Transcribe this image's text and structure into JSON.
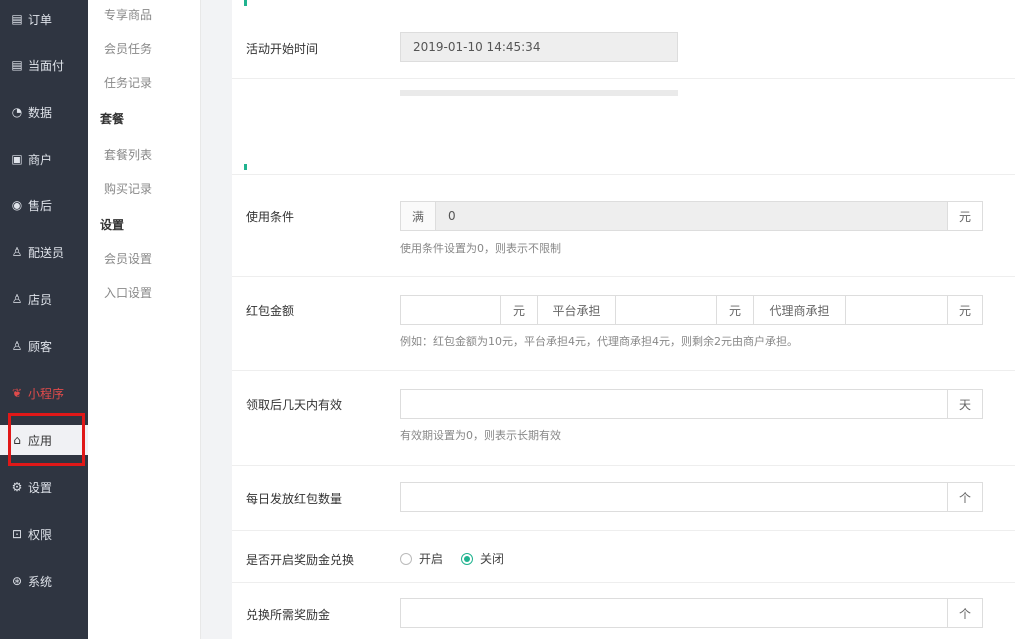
{
  "nav": {
    "items": [
      {
        "label": "订单",
        "icon": "order-icon",
        "glyph": "▤"
      },
      {
        "label": "当面付",
        "icon": "payment-icon",
        "glyph": "▤"
      },
      {
        "label": "数据",
        "icon": "chart-icon",
        "glyph": "◔"
      },
      {
        "label": "商户",
        "icon": "store-icon",
        "glyph": "▣"
      },
      {
        "label": "售后",
        "icon": "after-sales-icon",
        "glyph": "◉"
      },
      {
        "label": "配送员",
        "icon": "courier-icon",
        "glyph": "♙"
      },
      {
        "label": "店员",
        "icon": "staff-icon",
        "glyph": "♙"
      },
      {
        "label": "顾客",
        "icon": "customer-icon",
        "glyph": "♙"
      },
      {
        "label": "小程序",
        "icon": "miniprogram-icon",
        "glyph": "❦"
      },
      {
        "label": "应用",
        "icon": "app-icon",
        "glyph": "⌂"
      },
      {
        "label": "设置",
        "icon": "settings-icon",
        "glyph": "⚙"
      },
      {
        "label": "权限",
        "icon": "lock-icon",
        "glyph": "⊡"
      },
      {
        "label": "系统",
        "icon": "system-icon",
        "glyph": "⊛"
      }
    ]
  },
  "submenu": {
    "items": [
      {
        "label": "专享商品",
        "type": "item"
      },
      {
        "label": "会员任务",
        "type": "item"
      },
      {
        "label": "任务记录",
        "type": "item"
      },
      {
        "label": "套餐",
        "type": "head"
      },
      {
        "label": "套餐列表",
        "type": "item"
      },
      {
        "label": "购买记录",
        "type": "item"
      },
      {
        "label": "设置",
        "type": "head"
      },
      {
        "label": "会员设置",
        "type": "item"
      },
      {
        "label": "入口设置",
        "type": "item"
      }
    ]
  },
  "form": {
    "start_time": {
      "label": "活动开始时间",
      "value": "2019-01-10 14:45:34"
    },
    "condition": {
      "label": "使用条件",
      "prefix": "满",
      "value": "0",
      "suffix": "元",
      "hint": "使用条件设置为0，则表示不限制"
    },
    "amount": {
      "label": "红包金额",
      "unit": "元",
      "platform_label": "平台承担",
      "agent_label": "代理商承担",
      "hint": "例如：红包金额为10元，平台承担4元，代理商承担4元，则剩余2元由商户承担。"
    },
    "valid_days": {
      "label": "领取后几天内有效",
      "suffix": "天",
      "hint": "有效期设置为0，则表示长期有效"
    },
    "daily_count": {
      "label": "每日发放红包数量",
      "suffix": "个"
    },
    "reward_switch": {
      "label": "是否开启奖励金兑换",
      "options": [
        "开启",
        "关闭"
      ],
      "selected": "关闭"
    },
    "reward_required": {
      "label": "兑换所需奖励金",
      "suffix": "个"
    }
  },
  "colors": {
    "accent": "#20b38f",
    "highlight": "#e01818",
    "nav_bg": "#2f3541"
  }
}
